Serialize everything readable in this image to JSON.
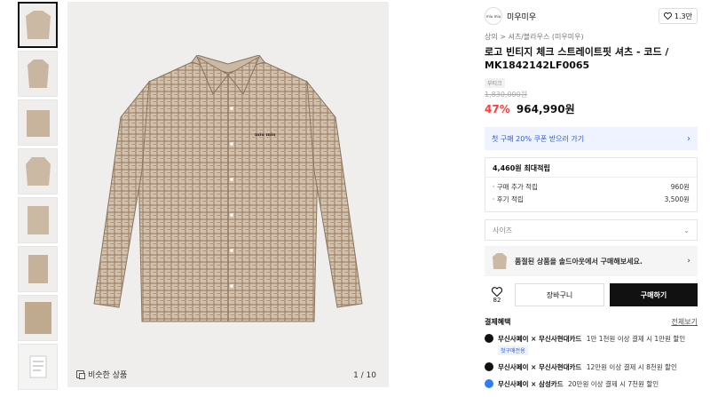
{
  "thumbnails": [
    {
      "name": "thumb-1",
      "active": true
    },
    {
      "name": "thumb-2",
      "active": false
    },
    {
      "name": "thumb-3",
      "active": false
    },
    {
      "name": "thumb-4",
      "active": false
    },
    {
      "name": "thumb-5",
      "active": false
    },
    {
      "name": "thumb-6",
      "active": false
    },
    {
      "name": "thumb-7",
      "active": false
    },
    {
      "name": "thumb-8",
      "active": false
    }
  ],
  "gallery": {
    "similar_label": "비슷한 상품",
    "pager": "1 / 10",
    "shirt_logo": "miu miu"
  },
  "brand": {
    "logo_text": "miu miu",
    "name": "미우미우",
    "likes": "1.3만"
  },
  "breadcrumb": "상의 > 셔츠/블라우스 (미우미우)",
  "product": {
    "title": "로고 빈티지 체크 스트레이트핏 셔츠 - 코드 / MK1842142LF0065",
    "badge": "부티크",
    "original_price": "1,830,000원",
    "discount": "47%",
    "price": "964,990원"
  },
  "coupon": {
    "text": "첫 구매 20% 쿠폰 받으러 가기"
  },
  "points": {
    "header": "4,460원 최대적립",
    "lines": [
      {
        "label": "· 구매 추가 적립",
        "value": "960원"
      },
      {
        "label": "· 후기 적립",
        "value": "3,500원"
      }
    ]
  },
  "size_select": {
    "placeholder": "사이즈"
  },
  "soldout_banner": {
    "text": "품절된 상품을 솔드아웃에서 구매해보세요."
  },
  "actions": {
    "wish_count": "82",
    "cart_label": "장바구니",
    "buy_label": "구매하기"
  },
  "benefits": {
    "title": "결제혜택",
    "more": "전체보기",
    "items": [
      {
        "strong": "무신사페이 × 무신사현대카드",
        "text": "1만 1천원 이상 결제 시 1만원 할인",
        "sub": "첫구매전용"
      },
      {
        "strong": "무신사페이 × 무신사현대카드",
        "text": "12만원 이상 결제 시 8천원 할인",
        "sub": ""
      },
      {
        "strong": "무신사페이 × 삼성카드",
        "text": "20만원 이상 결제 시 7천원 할인",
        "sub": ""
      }
    ]
  },
  "colors": {
    "discount": "#ff3b3b",
    "coupon_text": "#2f5bdc",
    "coupon_bg": "#eef3ff",
    "buy_button": "#111111",
    "shirt": "#cbb9a4"
  }
}
